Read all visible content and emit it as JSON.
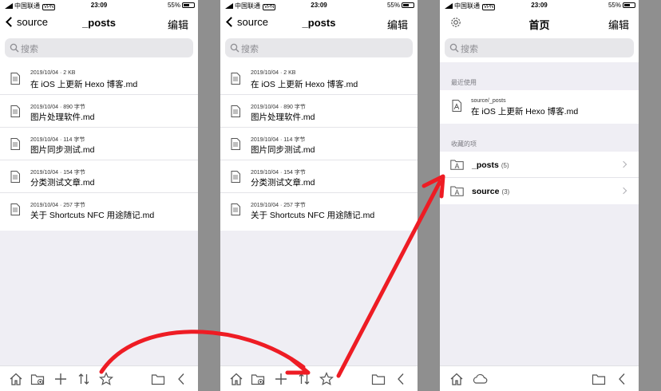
{
  "status": {
    "carrier": "中国联通",
    "vpn": "VPN",
    "time": "23:09",
    "battery": "55%"
  },
  "panel1": {
    "nav": {
      "back": "source",
      "title": "_posts",
      "edit": "编辑"
    },
    "search_placeholder": "搜索",
    "files": [
      {
        "meta": "2019/10/04  ·  2 KB",
        "name": "在 iOS 上更新 Hexo 博客.md"
      },
      {
        "meta": "2019/10/04  ·  890 字节",
        "name": "图片处理软件.md"
      },
      {
        "meta": "2019/10/04  ·  114 字节",
        "name": "图片同步测试.md"
      },
      {
        "meta": "2019/10/04  ·  154 字节",
        "name": "分类测试文章.md"
      },
      {
        "meta": "2019/10/04  ·  257 字节",
        "name": "关于 Shortcuts NFC 用途随记.md"
      }
    ]
  },
  "panel2": {
    "nav": {
      "back": "source",
      "title": "_posts",
      "edit": "编辑"
    },
    "search_placeholder": "搜索",
    "files": [
      {
        "meta": "2019/10/04  ·  2 KB",
        "name": "在 iOS 上更新 Hexo 博客.md"
      },
      {
        "meta": "2019/10/04  ·  890 字节",
        "name": "图片处理软件.md"
      },
      {
        "meta": "2019/10/04  ·  114 字节",
        "name": "图片同步测试.md"
      },
      {
        "meta": "2019/10/04  ·  154 字节",
        "name": "分类测试文章.md"
      },
      {
        "meta": "2019/10/04  ·  257 字节",
        "name": "关于 Shortcuts NFC 用途随记.md"
      }
    ]
  },
  "panel3": {
    "nav": {
      "title": "首页",
      "edit": "编辑"
    },
    "search_placeholder": "搜索",
    "recent_header": "最近使用",
    "recent": {
      "path": "source/_posts",
      "name": "在 iOS 上更新 Hexo 博客.md"
    },
    "favorites_header": "收藏的项",
    "favorites": [
      {
        "label": "_posts",
        "count": "(5)"
      },
      {
        "label": "source",
        "count": "(3)"
      }
    ]
  },
  "toolbar_icons": [
    "home-icon",
    "new-folder-icon",
    "add-icon",
    "sort-icon",
    "star-icon",
    "folder-icon",
    "chevron-left-icon"
  ],
  "home_toolbar_icons": [
    "home-icon",
    "cloud-icon",
    "folder-icon",
    "chevron-left-icon"
  ],
  "colors": {
    "annotation_arrow": "#ee1c24",
    "background": "#efeef4",
    "divider_gap": "#8f8f8f"
  }
}
